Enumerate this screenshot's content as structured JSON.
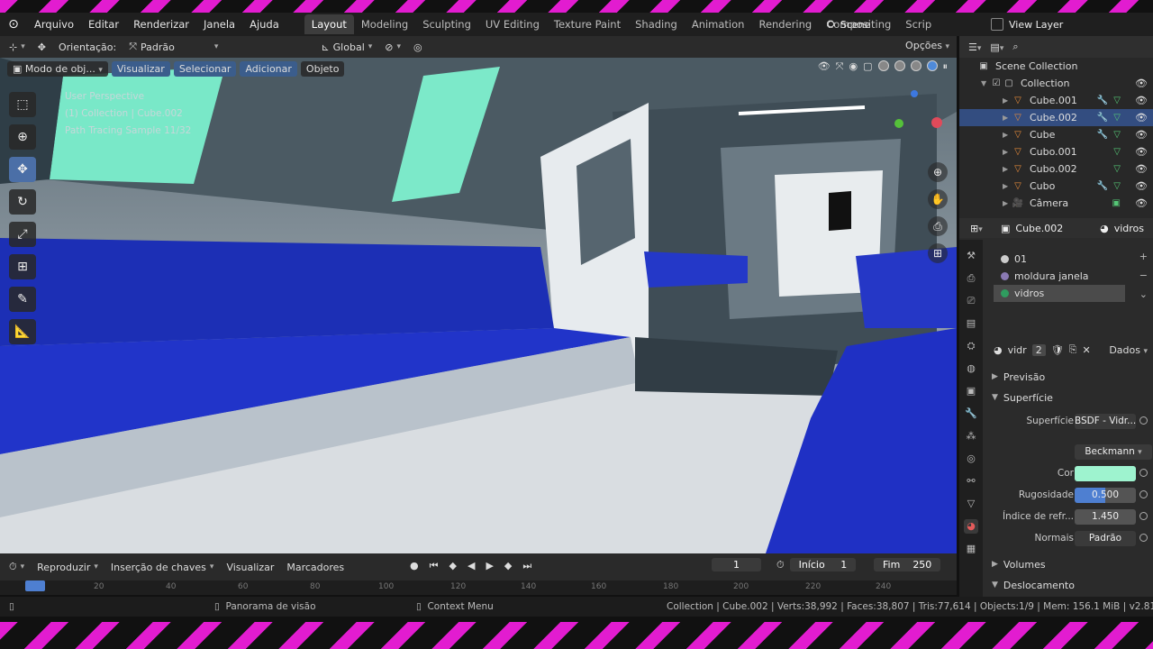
{
  "menu": [
    "Arquivo",
    "Editar",
    "Renderizar",
    "Janela",
    "Ajuda"
  ],
  "workspaces": [
    {
      "label": "Layout",
      "active": true
    },
    {
      "label": "Modeling"
    },
    {
      "label": "Sculpting"
    },
    {
      "label": "UV Editing"
    },
    {
      "label": "Texture Paint"
    },
    {
      "label": "Shading"
    },
    {
      "label": "Animation"
    },
    {
      "label": "Rendering"
    },
    {
      "label": "Compositing"
    },
    {
      "label": "Scrip"
    }
  ],
  "scene_label": "Scene",
  "view_layer_label": "View Layer",
  "toolbar": {
    "orientation_label": "Orientação:",
    "orientation_value": "Padrão",
    "transform_value": "Global",
    "options_label": "Opções"
  },
  "viewport_header": {
    "mode": "Modo de obj...",
    "view": "Visualizar",
    "select": "Selecionar",
    "add": "Adicionar",
    "object": "Objeto"
  },
  "overlay": {
    "line1": "User Perspective",
    "line2": "(1) Collection | Cube.002",
    "line3": "Path Tracing Sample 11/32"
  },
  "timeline": {
    "play": "Reproduzir",
    "keying": "Inserção de chaves",
    "view": "Visualizar",
    "markers": "Marcadores",
    "current_frame": "1",
    "start_label": "Início",
    "start": "1",
    "end_label": "Fim",
    "end": "250",
    "ruler": [
      "20",
      "40",
      "60",
      "80",
      "100",
      "120",
      "140",
      "160",
      "180",
      "200",
      "220",
      "240"
    ]
  },
  "status": {
    "pan": "Panorama de visão",
    "context": "Context Menu",
    "stats": "Collection | Cube.002 | Verts:38,992 | Faces:38,807 | Tris:77,614 | Objects:1/9 | Mem: 156.1 MiB | v2.81.16"
  },
  "outliner": {
    "root": "Scene Collection",
    "collection": "Collection",
    "items": [
      {
        "name": "Cube.001",
        "selected": false
      },
      {
        "name": "Cube.002",
        "selected": true
      },
      {
        "name": "Cube",
        "selected": false
      },
      {
        "name": "Cubo.001",
        "selected": false
      },
      {
        "name": "Cubo.002",
        "selected": false
      },
      {
        "name": "Cubo",
        "selected": false
      },
      {
        "name": "Câmera",
        "selected": false
      }
    ]
  },
  "properties": {
    "object_name": "Cube.002",
    "material_name": "vidros",
    "slots": [
      {
        "name": "01",
        "selected": false
      },
      {
        "name": "moldura janela",
        "selected": false
      },
      {
        "name": "vidros",
        "selected": true
      }
    ],
    "mat_field": "vidr",
    "mat_users": "2",
    "dados": "Dados",
    "preview_label": "Previsão",
    "surface_label": "Superfície",
    "fields": {
      "surface_lbl": "Superfície",
      "surface_val": "BSDF - Vidr...",
      "distribution_val": "Beckmann",
      "color_lbl": "Cor",
      "roughness_lbl": "Rugosidade",
      "roughness_val": "0.500",
      "ior_lbl": "Índice de refr...",
      "ior_val": "1.450",
      "normals_lbl": "Normais",
      "normals_val": "Padrão"
    },
    "volumes_label": "Volumes",
    "displacement_label": "Deslocamento"
  },
  "colors": {
    "accent": "#4e7fd1",
    "selection": "#334d80",
    "glass_color": "#9ef3cf",
    "magenta_frame": "#e21cd0"
  }
}
